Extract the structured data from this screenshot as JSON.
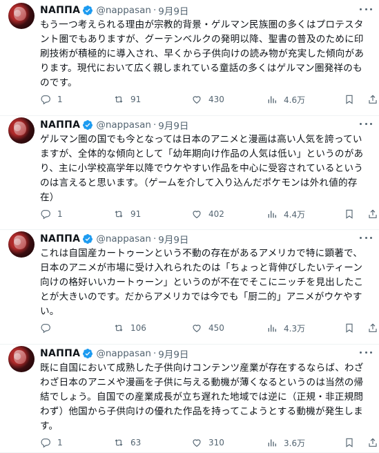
{
  "tweets": [
    {
      "name": "NAΠΠA",
      "handle": "@nappasan",
      "date": "9月9日",
      "lines": [
        "もう一つ考えられる理由が宗教的背景・ゲルマン民族圏の多くはプロテスタ",
        "ント圏でもありますが、グーテンベルクの発明以降、聖書の普及のために印",
        "刷技術が積極的に導入され、早くから子供向けの読み物が充実した傾向があ",
        "ります。現代において広く親しまれている童話の多くはゲルマン圏発祥のも",
        "のです。"
      ],
      "replies": "1",
      "retweets": "91",
      "likes": "430",
      "views": "4.6万"
    },
    {
      "name": "NAΠΠA",
      "handle": "@nappasan",
      "date": "9月9日",
      "lines": [
        "ゲルマン圏の国でも今となっては日本のアニメと漫画は高い人気を誇ってい",
        "ますが、全体的な傾向として「幼年期向け作品の人気は低い」というのがあ",
        "り、主に小学校高学年以降でウケやすい作品を中心に受容されているという",
        "のは言えると思います。（ゲームを介して入り込んだポケモンは外れ値的存",
        "在）"
      ],
      "replies": "1",
      "retweets": "91",
      "likes": "402",
      "views": "4.4万"
    },
    {
      "name": "NAΠΠA",
      "handle": "@nappasan",
      "date": "9月9日",
      "lines": [
        "これは自国産カートゥーンという不動の存在があるアメリカで特に顕著で、",
        "日本のアニメが市場に受け入れられたのは「ちょっと背伸びしたいティーン",
        "向けの格好いいカートゥーン」というのが不在でそこにニッチを見出したこ",
        "とが大きいのです。だからアメリカでは今でも「厨二的」アニメがウケやす",
        "い。"
      ],
      "replies": "",
      "retweets": "106",
      "likes": "450",
      "views": "4.3万"
    },
    {
      "name": "NAΠΠA",
      "handle": "@nappasan",
      "date": "9月9日",
      "lines": [
        "既に自国において成熟した子供向けコンテンツ産業が存在するならば、わざ",
        "わざ日本のアニメや漫画を子供に与える動機が薄くなるというのは当然の帰",
        "結でしょう。自国での産業成長が立ち遅れた地域では逆に（正規・非正規問",
        "わず）他国から子供向けの優れた作品を持ってこようとする動機が発生しま",
        "す。"
      ],
      "replies": "1",
      "retweets": "63",
      "likes": "310",
      "views": "3.6万"
    }
  ],
  "icons": {
    "verified": "verified-badge-icon",
    "more": "more-dots-icon",
    "reply": "reply-icon",
    "retweet": "retweet-icon",
    "like": "heart-icon",
    "views": "views-bar-chart-icon",
    "bookmark": "bookmark-icon",
    "share": "share-icon"
  },
  "colors": {
    "verified": "#1d9bf0",
    "muted": "#536471",
    "text": "#0f1419"
  }
}
